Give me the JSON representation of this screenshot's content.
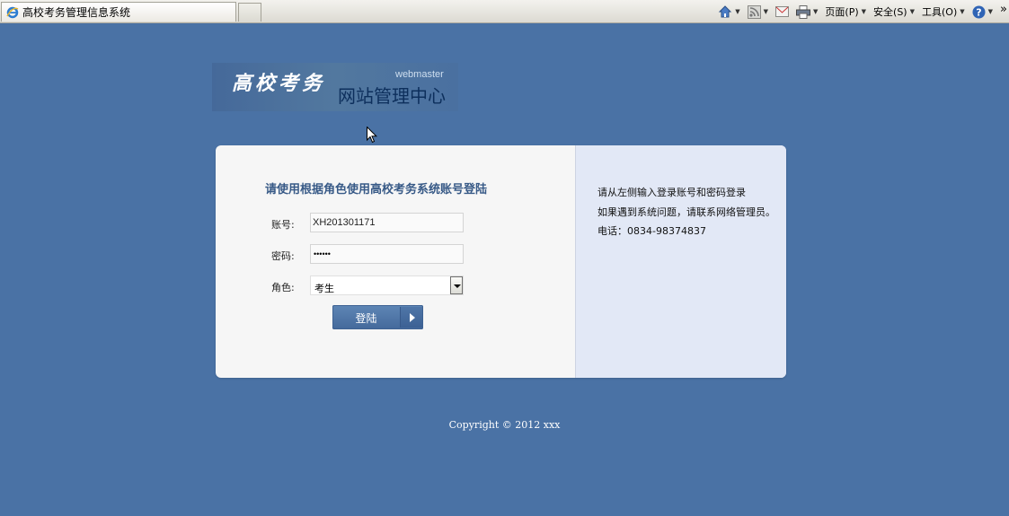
{
  "browser": {
    "tab_title": "高校考务管理信息系统",
    "commands": {
      "page": "页面(P)",
      "safety": "安全(S)",
      "tools": "工具(O)",
      "more": "»"
    }
  },
  "logo": {
    "title": "高校考务",
    "en": "webmaster",
    "subtitle": "网站管理中心"
  },
  "form": {
    "title": "请使用根据角色使用高校考务系统账号登陆",
    "account_label": "账号:",
    "account_value": "XH201301171",
    "password_label": "密码:",
    "password_value": "••••••",
    "role_label": "角色:",
    "role_value": "考生",
    "submit_label": "登陆"
  },
  "info": {
    "line1": "请从左侧输入登录账号和密码登录",
    "line2": "如果遇到系统问题，请联系网络管理员。",
    "line3": "电话：0834-98374837"
  },
  "footer": {
    "copyright": "Copyright © 2012 xxx"
  },
  "colors": {
    "background": "#4a72a5",
    "button": "#4f76a8",
    "title": "#385a87"
  }
}
